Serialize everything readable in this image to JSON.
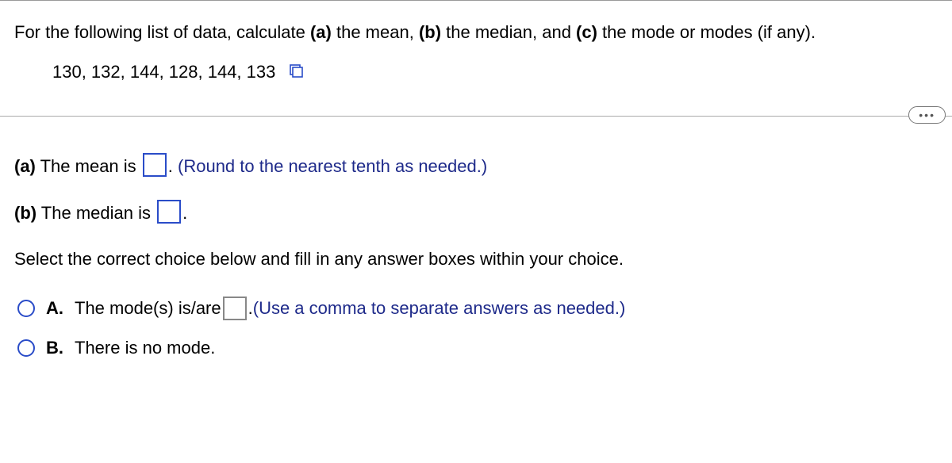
{
  "stem_prefix": "For the following list of data, calculate ",
  "stem_a_bold": "(a)",
  "stem_a_text": " the mean, ",
  "stem_b_bold": "(b)",
  "stem_b_text": " the median, and ",
  "stem_c_bold": "(c)",
  "stem_c_text": " the mode or modes (if any).",
  "data_values": "130, 132, 144, 128, 144, 133",
  "more_label": "•••",
  "part_a_bold": "(a)",
  "part_a_lead": " The mean is ",
  "part_a_tail": ". ",
  "part_a_hint": "(Round to the nearest tenth as needed.)",
  "part_b_bold": "(b)",
  "part_b_lead": " The median is ",
  "part_b_tail": ".",
  "choice_instruction": "Select the correct choice below and fill in any answer boxes within your choice.",
  "choice_A_letter": "A.",
  "choice_A_lead": "The mode(s) is/are ",
  "choice_A_tail": ". ",
  "choice_A_hint": "(Use a comma to separate answers as needed.)",
  "choice_B_letter": "B.",
  "choice_B_text": "There is no mode."
}
